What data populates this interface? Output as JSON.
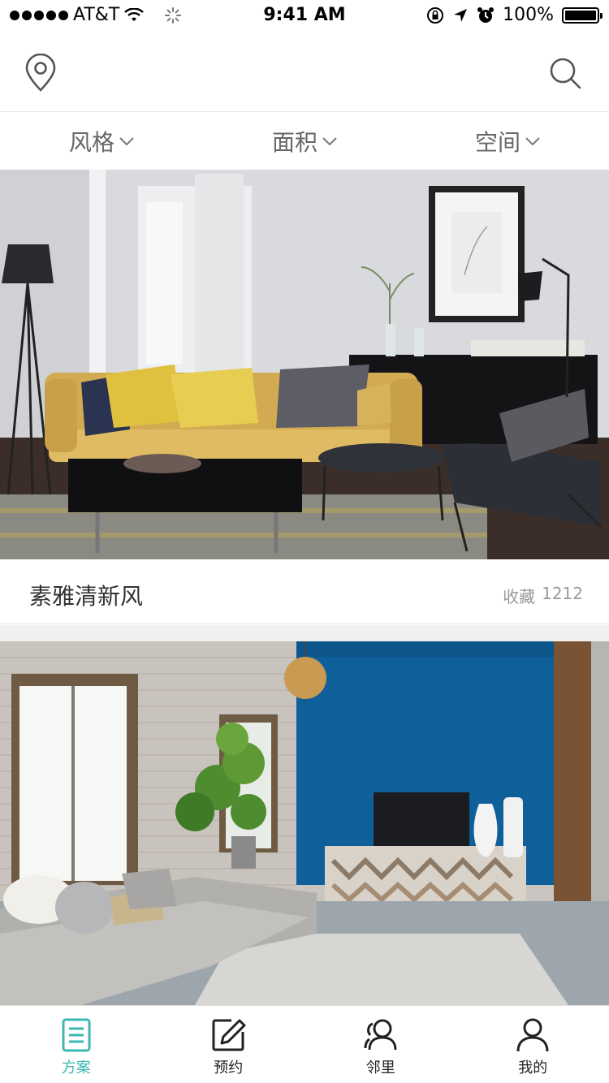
{
  "status_bar": {
    "carrier": "AT&T",
    "time": "9:41 AM",
    "battery": "100%"
  },
  "nav": {
    "location_icon": "location-pin-icon",
    "search_icon": "search-icon"
  },
  "filters": [
    {
      "label": "风格"
    },
    {
      "label": "面积"
    },
    {
      "label": "空间"
    }
  ],
  "feed": [
    {
      "title": "素雅清新风",
      "fav_label": "收藏",
      "fav_count": "1212"
    }
  ],
  "tabs": [
    {
      "label": "方案",
      "icon": "document-list-icon",
      "active": true
    },
    {
      "label": "预约",
      "icon": "edit-icon",
      "active": false
    },
    {
      "label": "邻里",
      "icon": "people-icon",
      "active": false
    },
    {
      "label": "我的",
      "icon": "person-icon",
      "active": false
    }
  ],
  "colors": {
    "accent": "#3bb8b2",
    "text": "#333333",
    "muted": "#999999",
    "divider": "#f0f0f0"
  }
}
